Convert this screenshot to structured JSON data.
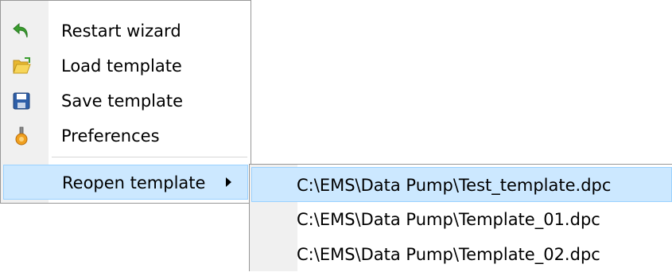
{
  "main_menu": {
    "items": [
      {
        "label": "Restart wizard",
        "icon": "restart-arrow-icon"
      },
      {
        "label": "Load template",
        "icon": "open-folder-icon"
      },
      {
        "label": "Save template",
        "icon": "floppy-disk-icon"
      },
      {
        "label": "Preferences",
        "icon": "preferences-icon"
      }
    ],
    "reopen": {
      "label": "Reopen template",
      "icon": "submenu-arrow-icon"
    }
  },
  "sub_menu": {
    "items": [
      {
        "label": "C:\\EMS\\Data Pump\\Test_template.dpc"
      },
      {
        "label": "C:\\EMS\\Data Pump\\Template_01.dpc"
      },
      {
        "label": "C:\\EMS\\Data Pump\\Template_02.dpc"
      }
    ]
  },
  "colors": {
    "highlight_fill": "#cce8ff",
    "highlight_border": "#99d1ff",
    "gutter": "#f0f0f0",
    "menu_border": "#979797"
  }
}
